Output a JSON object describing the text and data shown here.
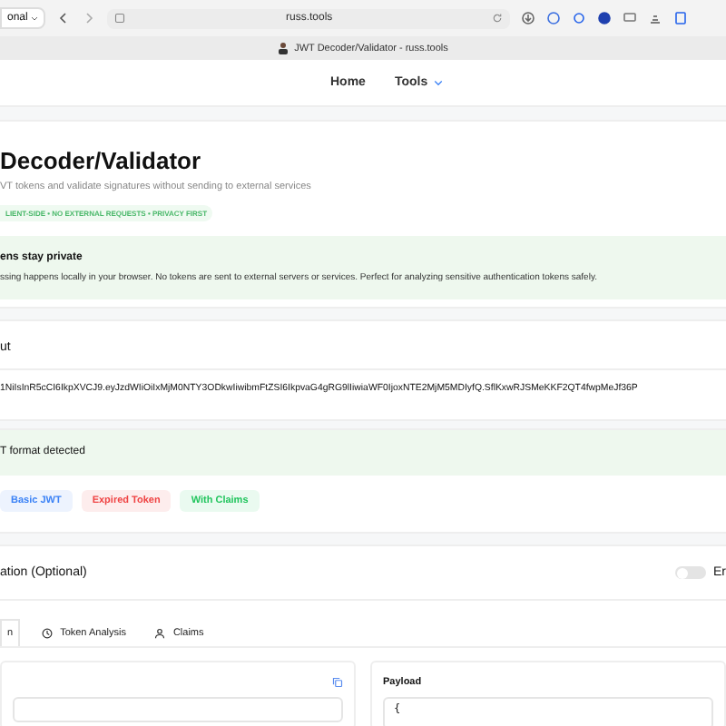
{
  "browser": {
    "profile": "onal",
    "url": "russ.tools",
    "tab_title": "JWT Decoder/Validator - russ.tools"
  },
  "nav": [
    {
      "label": "Home",
      "dropdown": false
    },
    {
      "label": "Tools",
      "dropdown": true
    }
  ],
  "header": {
    "title": "Decoder/Validator",
    "subtitle": "VT tokens and validate signatures without sending to external services",
    "badge": "LIENT-SIDE • NO EXTERNAL REQUESTS • PRIVACY FIRST"
  },
  "privacy": {
    "title": "ens stay private",
    "text": "ssing happens locally in your browser. No tokens are sent to external servers or services. Perfect for analyzing sensitive authentication tokens safely."
  },
  "input": {
    "title": "ut",
    "token": "1NiIsInR5cCI6IkpXVCJ9.eyJzdWIiOiIxMjM0NTY3ODkwIiwibmFtZSI6IkpvaG4gRG9lIiwiaWF0IjoxNTE2MjM5MDIyfQ.SflKxwRJSMeKKF2QT4fwpMeJf36P"
  },
  "status": {
    "text": "T format detected",
    "valid": true
  },
  "examples": [
    {
      "label": "Basic JWT",
      "color": "#3b82f6"
    },
    {
      "label": "Expired Token",
      "color": "#ef4444"
    },
    {
      "label": "With Claims",
      "color": "#22c55e"
    }
  ],
  "validation": {
    "title": "ation (Optional)",
    "enabled": false,
    "toggle_label": "Er"
  },
  "tabs": [
    {
      "label": "n",
      "selected": true
    },
    {
      "label": "Token Analysis",
      "selected": false
    },
    {
      "label": "Claims",
      "selected": false
    }
  ],
  "panels": {
    "right": {
      "title": "Payload",
      "content": "{"
    }
  }
}
